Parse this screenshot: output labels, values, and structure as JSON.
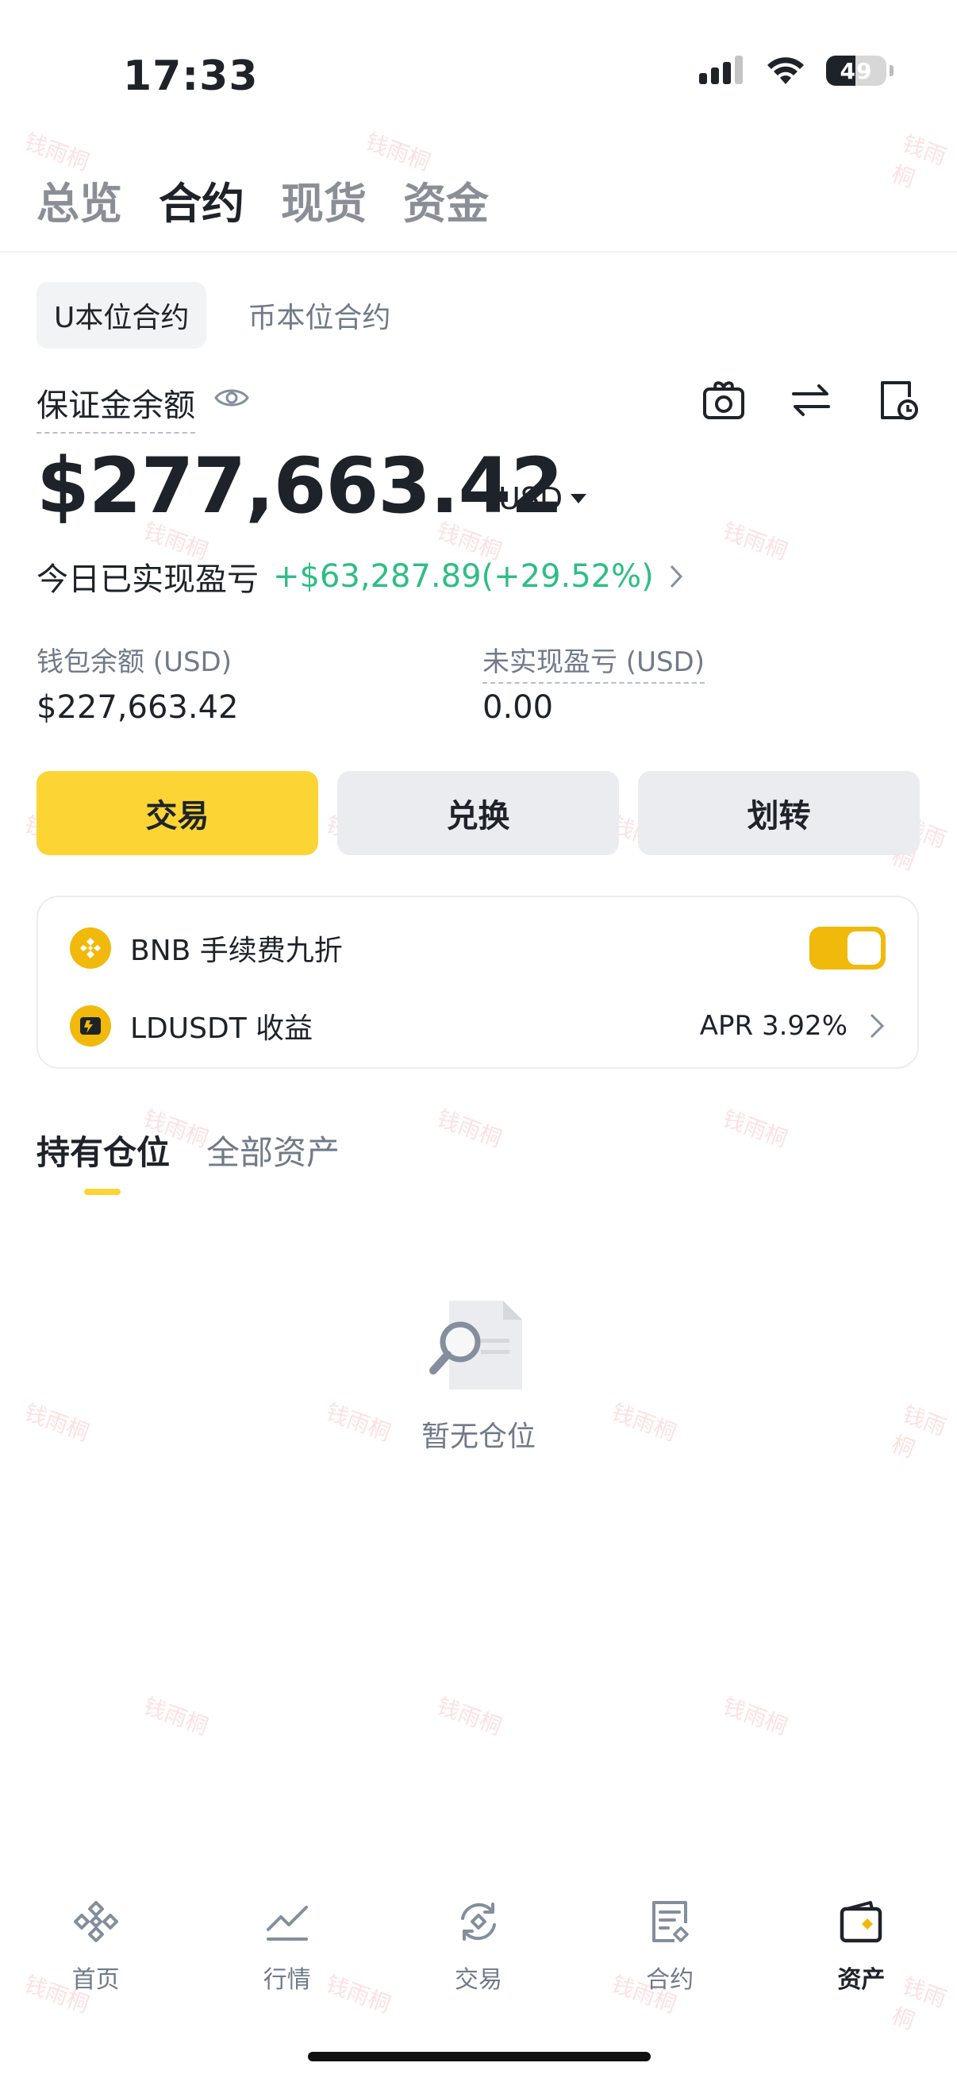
{
  "status_bar": {
    "time": "17:33",
    "battery": "49"
  },
  "top_tabs": [
    "总览",
    "合约",
    "现货",
    "资金"
  ],
  "sub_tabs": [
    "U本位合约",
    "币本位合约"
  ],
  "margin": {
    "label": "保证金余额",
    "balance": "$277,663.42",
    "currency": "USD"
  },
  "today": {
    "label": "今日已实现盈亏",
    "value": "+$63,287.89(+29.52%)"
  },
  "wallet": {
    "label": "钱包余额 (USD)",
    "value": "$227,663.42"
  },
  "unrealized": {
    "label": "未实现盈亏 (USD)",
    "value": "0.00"
  },
  "actions": {
    "trade": "交易",
    "convert": "兑换",
    "transfer": "划转"
  },
  "options": {
    "bnb_label": "BNB 手续费九折",
    "bnb_toggle_on": true,
    "ld_label": "LDUSDT 收益",
    "ld_apr": "APR 3.92%"
  },
  "position_tabs": [
    "持有仓位",
    "全部资产"
  ],
  "empty": {
    "text": "暂无仓位"
  },
  "bottom_nav": [
    {
      "label": "首页",
      "icon": "binance-logo-icon"
    },
    {
      "label": "行情",
      "icon": "chart-trend-icon"
    },
    {
      "label": "交易",
      "icon": "exchange-cycle-icon"
    },
    {
      "label": "合约",
      "icon": "contract-doc-icon"
    },
    {
      "label": "资产",
      "icon": "wallet-icon"
    }
  ],
  "watermark": "钱雨桐",
  "colors": {
    "accent": "#fcd535",
    "positive": "#2ebd85",
    "brand": "#f0b90b"
  }
}
